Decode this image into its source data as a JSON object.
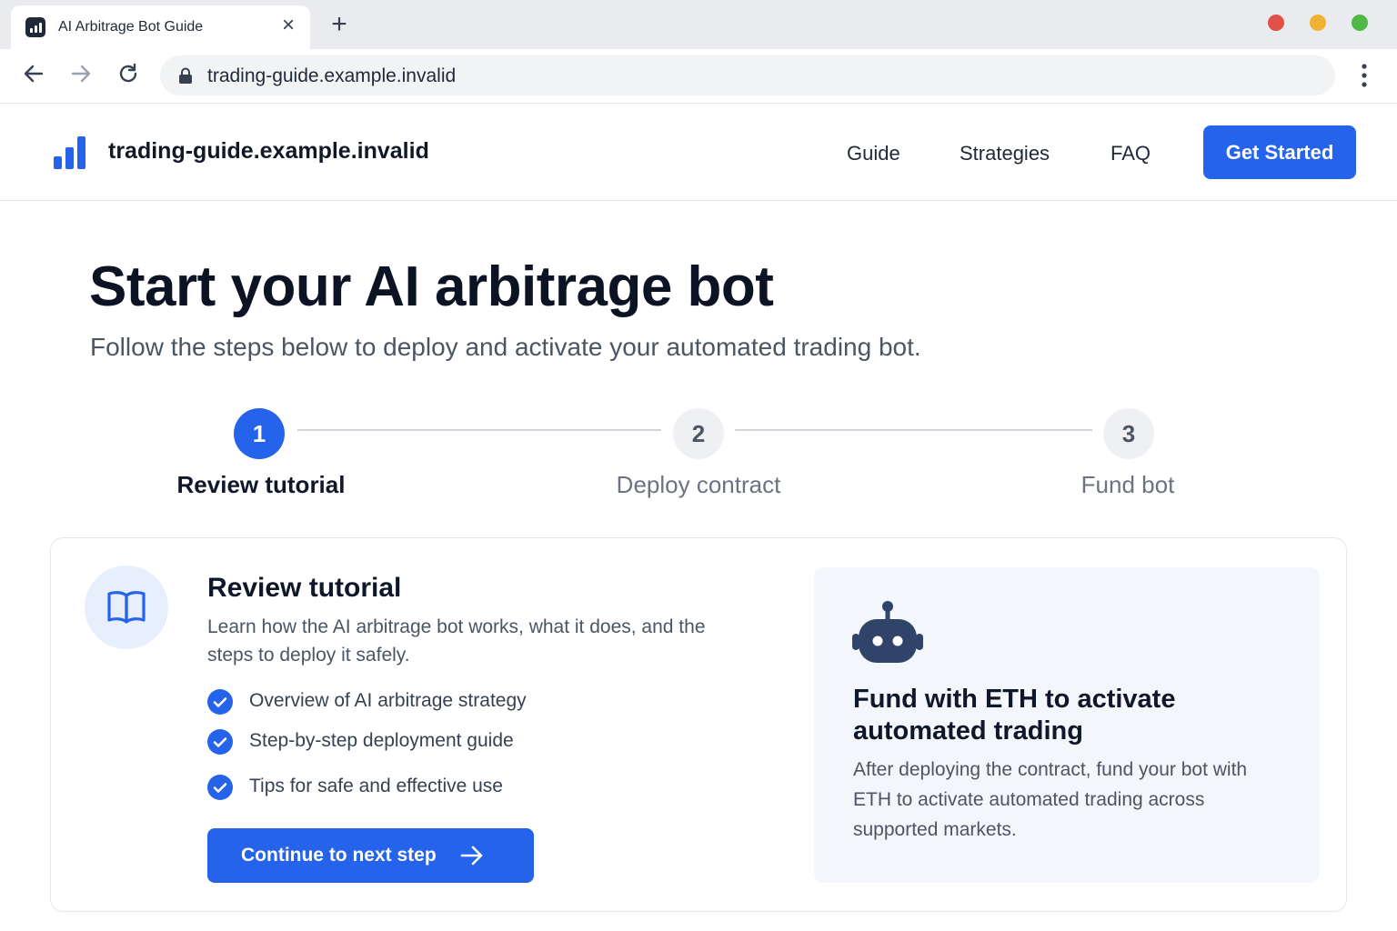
{
  "browser": {
    "tab_title": "AI Arbitrage Bot Guide",
    "url": "trading-guide.example.invalid",
    "icons": [
      "favicon-icon",
      "close-icon",
      "plus-icon",
      "back-arrow-icon",
      "forward-arrow-icon",
      "reload-icon",
      "lock-icon",
      "kebab-menu-icon"
    ]
  },
  "header": {
    "site_name": "trading-guide.example.invalid",
    "nav": [
      "Guide",
      "Strategies",
      "FAQ"
    ],
    "cta_label": "Get Started"
  },
  "hero": {
    "title": "Start your AI arbitrage bot",
    "subtitle": "Follow the steps below to deploy and activate your automated trading bot."
  },
  "steps": [
    {
      "number": "1",
      "label": "Review tutorial",
      "active": true
    },
    {
      "number": "2",
      "label": "Deploy contract",
      "active": false
    },
    {
      "number": "3",
      "label": "Fund bot",
      "active": false
    }
  ],
  "card": {
    "title": "Review tutorial",
    "description": "Learn how the AI arbitrage bot works, what it does, and the steps to deploy it safely.",
    "checklist": [
      "Overview of AI arbitrage strategy",
      "Step-by-step deployment guide",
      "Tips for safe and effective use"
    ],
    "button_label": "Continue to next step"
  },
  "side_panel": {
    "title": "Fund with ETH to activate automated trading",
    "description": "After deploying the contract, fund your bot with ETH to activate automated trading across supported markets."
  },
  "colors": {
    "accent": "#2563eb",
    "badge_bg": "#e8effc",
    "panel_bg": "#f3f6fb",
    "robot": "#2f4468"
  }
}
